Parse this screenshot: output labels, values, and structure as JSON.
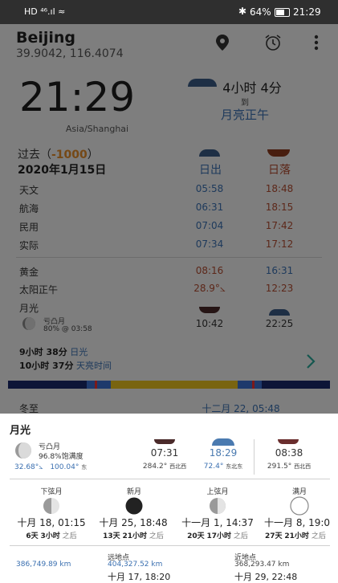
{
  "status_bar": {
    "left": "HD ⁴⁶.ıl ≈",
    "battery": "64%",
    "time": "21:29"
  },
  "header": {
    "city": "Beijing",
    "coords": "39.9042, 116.4074"
  },
  "clock": {
    "time": "21:29",
    "timezone": "Asia/Shanghai",
    "countdown": "4小时 4分",
    "to": "到",
    "event": "月亮正午"
  },
  "date_block": {
    "past_label": "过去",
    "offset": "-1000",
    "date": "2020年1月15日",
    "sunrise_header": "日出",
    "sunset_header": "日落"
  },
  "twilight_rows": [
    {
      "label": "天文",
      "rise": "05:58",
      "set": "18:48"
    },
    {
      "label": "航海",
      "rise": "06:31",
      "set": "18:15"
    },
    {
      "label": "民用",
      "rise": "07:04",
      "set": "17:42"
    },
    {
      "label": "实际",
      "rise": "07:34",
      "set": "17:12"
    }
  ],
  "golden": {
    "label": "黄金",
    "rise": "08:16",
    "set": "16:31"
  },
  "solar_noon": {
    "label": "太阳正午",
    "elevation": "28.9°⦣",
    "time": "12:23"
  },
  "moon_main": {
    "label": "月光",
    "phase": "亏凸月",
    "illum": "80% @ 03:58",
    "rise": "10:42",
    "set": "22:25"
  },
  "daylight": {
    "day_value": "9小时 38分",
    "day_label": "日光",
    "sky_value": "10小时 37分",
    "sky_label": "天亮时间"
  },
  "solstice": {
    "label": "冬至",
    "value": "十二月 22, 05:48"
  },
  "moon_sheet": {
    "title": "月光",
    "phase": "亏凸月",
    "fullness": "96.8%饱满度",
    "elevation": "32.68°⦣",
    "azimuth": "100.04°",
    "azimuth_dir": "东",
    "rise_time": "07:31",
    "rise_az": "284.2°",
    "rise_dir": "西北西",
    "transit_time": "18:29",
    "transit_alt": "72.4°",
    "transit_dir": "东北东",
    "set_time": "08:38",
    "set_az": "291.5°",
    "set_dir": "西北西"
  },
  "phases": [
    {
      "name": "下弦月",
      "date": "十月 18, 01:15",
      "rel_a": "6天",
      "rel_b": "3小时",
      "rel_c": "之后"
    },
    {
      "name": "新月",
      "date": "十月 25, 18:48",
      "rel_a": "13天",
      "rel_b": "21小时",
      "rel_c": "之后"
    },
    {
      "name": "上弦月",
      "date": "十一月 1, 14:37",
      "rel_a": "20天",
      "rel_b": "17小时",
      "rel_c": "之后"
    },
    {
      "name": "满月",
      "date": "十一月 8, 19:0",
      "rel_a": "27天",
      "rel_b": "21小时",
      "rel_c": "之后"
    }
  ],
  "distance": {
    "current": "386,749.89 km",
    "apogee_label": "远地点",
    "apogee_dist": "404,327.52 km",
    "apogee_date": "十月 17, 18:20",
    "perigee_label": "近地点",
    "perigee_dist": "368,293.47 km",
    "perigee_date": "十月 29, 22:48"
  },
  "colors": {
    "accent_blue": "#3a6fb0",
    "accent_red": "#b04b30",
    "offset_orange": "#e08a2a",
    "sun_yellow": "#e8c020",
    "night_navy": "#1a2a6a"
  }
}
